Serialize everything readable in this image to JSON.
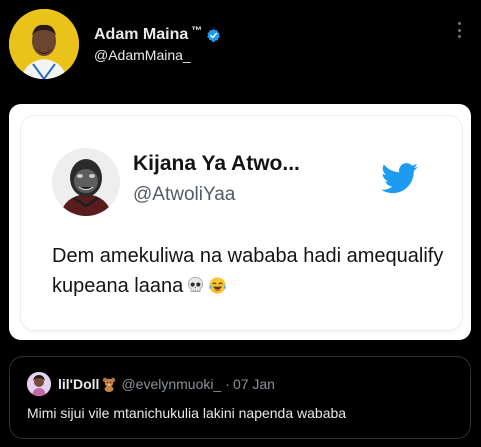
{
  "author": {
    "name": "Adam Maina",
    "trademark": "™",
    "handle": "@AdamMaina_",
    "avatar_color": "#e9c31a",
    "verified_color": "#1d9bf0"
  },
  "header": {
    "more_icon": "more-vertical-icon"
  },
  "embedded_tweet": {
    "name": "Kijana Ya Atwo...",
    "handle": "@AtwoliYaa",
    "text": "Dem amekuliwa na wababa hadi amequalify kupeana laana",
    "emojis": [
      "skull-emoji",
      "tears-of-joy-emoji"
    ],
    "brand_icon": "twitter-bird-icon",
    "brand_color": "#1d9bf0"
  },
  "reply": {
    "name": "lil'Doll",
    "handle": "@evelynmuoki_",
    "separator": "·",
    "date": "07 Jan",
    "text": "Mimi sijui vile mtanichukulia lakini napenda wababa"
  }
}
